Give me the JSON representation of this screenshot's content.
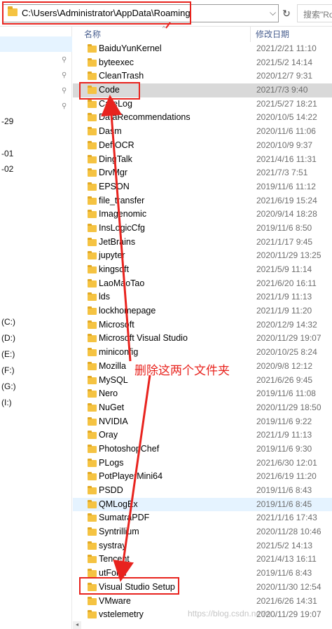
{
  "address_bar": {
    "path": "C:\\Users\\Administrator\\AppData\\Roaming",
    "dropdown_glyph": "⌵",
    "refresh_glyph": "↻",
    "search_placeholder": "搜索\"Ro"
  },
  "nav_pane": {
    "fragments": [
      "-29",
      "-01",
      "-02",
      "(C:)",
      "(D:)",
      "(E:)",
      "(F:)",
      "(G:)",
      "(I:)"
    ],
    "pin_glyph": "📌"
  },
  "columns": {
    "name": "名称",
    "modified": "修改日期",
    "sort_glyph": "^"
  },
  "rows": [
    {
      "name": "BaiduYunKernel",
      "date": "2021/2/21 11:10",
      "state": ""
    },
    {
      "name": "byteexec",
      "date": "2021/5/2 14:14",
      "state": ""
    },
    {
      "name": "CleanTrash",
      "date": "2020/12/7 9:31",
      "state": ""
    },
    {
      "name": "Code",
      "date": "2021/7/3 9:40",
      "state": "sel"
    },
    {
      "name": "CareLog",
      "date": "2021/5/27 18:21",
      "state": ""
    },
    {
      "name": "DataRecommendations",
      "date": "2020/10/5 14:22",
      "state": ""
    },
    {
      "name": "Dasm",
      "date": "2020/11/6 11:06",
      "state": ""
    },
    {
      "name": "DeftOCR",
      "date": "2020/10/9 9:37",
      "state": ""
    },
    {
      "name": "DingTalk",
      "date": "2021/4/16 11:31",
      "state": ""
    },
    {
      "name": "DrvMgr",
      "date": "2021/7/3 7:51",
      "state": ""
    },
    {
      "name": "EPSON",
      "date": "2019/11/6 11:12",
      "state": ""
    },
    {
      "name": "file_transfer",
      "date": "2021/6/19 15:24",
      "state": ""
    },
    {
      "name": "Imagenomic",
      "date": "2020/9/14 18:28",
      "state": ""
    },
    {
      "name": "InsLogicCfg",
      "date": "2019/11/6 8:50",
      "state": ""
    },
    {
      "name": "JetBrains",
      "date": "2021/1/17 9:45",
      "state": ""
    },
    {
      "name": "jupyter",
      "date": "2020/11/29 13:25",
      "state": ""
    },
    {
      "name": "kingsoft",
      "date": "2021/5/9 11:14",
      "state": ""
    },
    {
      "name": "LaoMaoTao",
      "date": "2021/6/20 16:11",
      "state": ""
    },
    {
      "name": "lds",
      "date": "2021/1/9 11:13",
      "state": ""
    },
    {
      "name": "lockhomepage",
      "date": "2021/1/9 11:20",
      "state": ""
    },
    {
      "name": "Microsoft",
      "date": "2020/12/9 14:32",
      "state": ""
    },
    {
      "name": "Microsoft Visual Studio",
      "date": "2020/11/29 19:07",
      "state": ""
    },
    {
      "name": "miniconfig",
      "date": "2020/10/25 8:24",
      "state": ""
    },
    {
      "name": "Mozilla",
      "date": "2020/9/8 12:12",
      "state": ""
    },
    {
      "name": "MySQL",
      "date": "2021/6/26 9:45",
      "state": ""
    },
    {
      "name": "Nero",
      "date": "2019/11/6 11:08",
      "state": ""
    },
    {
      "name": "NuGet",
      "date": "2020/11/29 18:50",
      "state": ""
    },
    {
      "name": "NVIDIA",
      "date": "2019/11/6 9:22",
      "state": ""
    },
    {
      "name": "Oray",
      "date": "2021/1/9 11:13",
      "state": ""
    },
    {
      "name": "PhotoshopChef",
      "date": "2019/11/6 9:30",
      "state": ""
    },
    {
      "name": "PLogs",
      "date": "2021/6/30 12:01",
      "state": ""
    },
    {
      "name": "PotPlayerMini64",
      "date": "2021/6/19 11:20",
      "state": ""
    },
    {
      "name": "PSDD",
      "date": "2019/11/6 8:43",
      "state": ""
    },
    {
      "name": "QMLogEx",
      "date": "2019/11/6 8:45",
      "state": "hov"
    },
    {
      "name": "SumatraPDF",
      "date": "2021/1/16 17:43",
      "state": ""
    },
    {
      "name": "Syntrillium",
      "date": "2020/11/28 10:46",
      "state": ""
    },
    {
      "name": "systray",
      "date": "2021/5/2 14:13",
      "state": ""
    },
    {
      "name": "Tencent",
      "date": "2021/4/13 16:11",
      "state": ""
    },
    {
      "name": "utForm",
      "date": "2019/11/6 8:43",
      "state": ""
    },
    {
      "name": "Visual Studio Setup",
      "date": "2020/11/30 12:54",
      "state": ""
    },
    {
      "name": "VMware",
      "date": "2021/6/26 14:31",
      "state": ""
    },
    {
      "name": "vstelemetry",
      "date": "2020/11/29 19:07",
      "state": ""
    }
  ],
  "annotation": {
    "text": "删除这两个文件夹",
    "color": "#e8231e"
  },
  "watermark": "https://blog.csdn.net/w..."
}
